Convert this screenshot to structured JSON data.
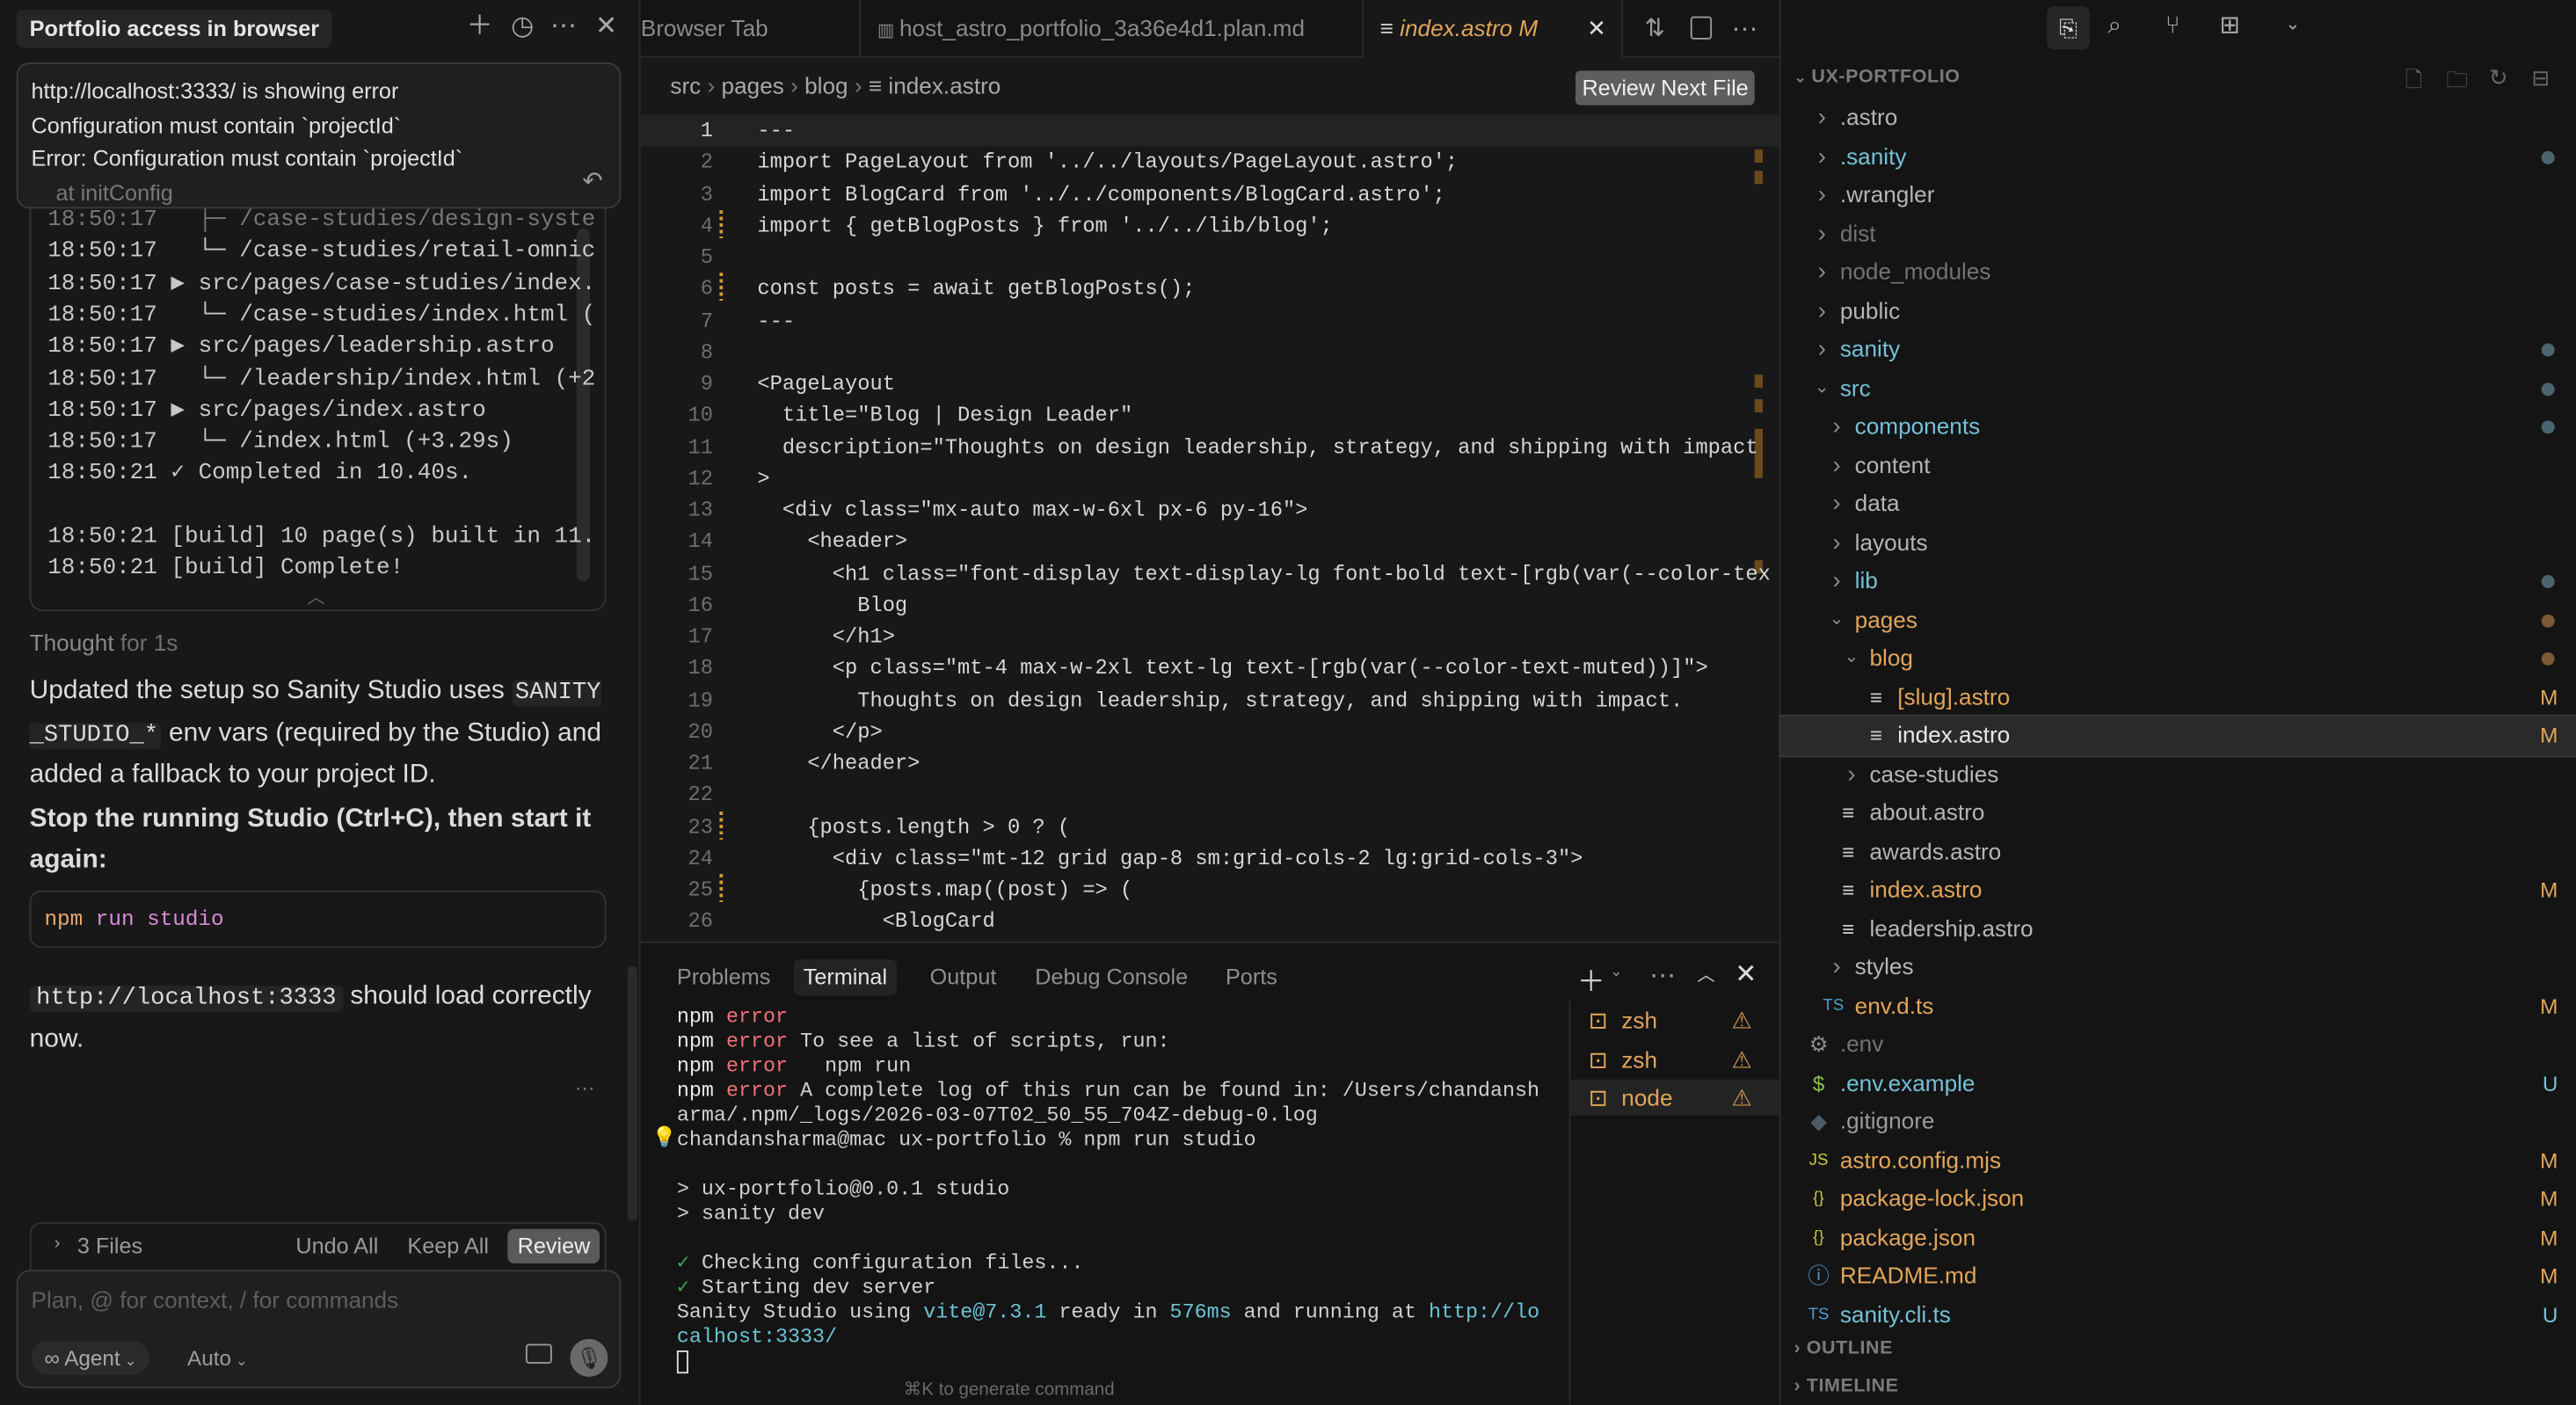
{
  "chat": {
    "title": "Portfolio access in browser",
    "header_icons": [
      "plus-icon",
      "history-icon",
      "more-icon",
      "close-icon"
    ],
    "popup": {
      "lines": [
        "http://localhost:3333/ is showing error",
        "Configuration must contain `projectId`",
        "Error: Configuration must contain `projectId`"
      ],
      "faded": "at initConfig"
    },
    "build_log": [
      "18:50:17   ├─ /case-studies/design-syste",
      "18:50:17   └─ /case-studies/retail-omnic",
      "18:50:17 ▶ src/pages/case-studies/index.",
      "18:50:17   └─ /case-studies/index.html (",
      "18:50:17 ▶ src/pages/leadership.astro",
      "18:50:17   └─ /leadership/index.html (+2",
      "18:50:17 ▶ src/pages/index.astro",
      "18:50:17   └─ /index.html (+3.29s)",
      "18:50:21 ✓ Completed in 10.40s.",
      "",
      "18:50:21 [build] 10 page(s) built in 11.",
      "18:50:21 [build] Complete!"
    ],
    "thought_label": "Thought",
    "thought_time": "for 1s",
    "msg1_a": "Updated the setup so Sanity Studio uses ",
    "msg1_code": "SANITY_STUDIO_*",
    "msg1_b": " env vars (required by the Studio) and added a fallback to your project ID.",
    "msg2": "Stop the running Studio (Ctrl+C), then start it again:",
    "code_block": {
      "cmd": "npm",
      "sub": "run",
      "arg": "studio"
    },
    "msg3_code": "http://localhost:3333",
    "msg3_b": " should load correctly now.",
    "more": "···",
    "files": {
      "count_label": "3 Files",
      "undo": "Undo All",
      "keep": "Keep All",
      "review": "Review"
    },
    "input": {
      "placeholder": "Plan, @ for context, / for commands",
      "mode": "Agent",
      "model": "Auto"
    }
  },
  "editor": {
    "tabs": [
      {
        "label": "Browser Tab",
        "active": false
      },
      {
        "label": "host_astro_portfolio_3a36e4d1.plan.md",
        "active": false
      },
      {
        "label": "index.astro",
        "badge": "M",
        "active": true
      }
    ],
    "breadcrumb": [
      "src",
      "pages",
      "blog",
      "index.astro"
    ],
    "review_next": "Review Next File",
    "lines": [
      "---",
      "import PageLayout from '../../layouts/PageLayout.astro';",
      "import BlogCard from '../../components/BlogCard.astro';",
      "import { getBlogPosts } from '../../lib/blog';",
      "",
      "const posts = await getBlogPosts();",
      "---",
      "",
      "<PageLayout",
      "  title=\"Blog | Design Leader\"",
      "  description=\"Thoughts on design leadership, strategy, and shipping with impact",
      ">",
      "  <div class=\"mx-auto max-w-6xl px-6 py-16\">",
      "    <header>",
      "      <h1 class=\"font-display text-display-lg font-bold text-[rgb(var(--color-tex",
      "        Blog",
      "      </h1>",
      "      <p class=\"mt-4 max-w-2xl text-lg text-[rgb(var(--color-text-muted))]\">",
      "        Thoughts on design leadership, strategy, and shipping with impact.",
      "      </p>",
      "    </header>",
      "",
      "    {posts.length > 0 ? (",
      "      <div class=\"mt-12 grid gap-8 sm:grid-cols-2 lg:grid-cols-3\">",
      "        {posts.map((post) => (",
      "          <BlogCard"
    ],
    "modified_lines": [
      4,
      6,
      23,
      25
    ]
  },
  "panel": {
    "tabs": [
      "Problems",
      "Terminal",
      "Output",
      "Debug Console",
      "Ports"
    ],
    "active_tab": "Terminal",
    "terminal": [
      [
        {
          "t": "npm ",
          "c": "#e8e8e8"
        },
        {
          "t": "error",
          "c": "#f07178"
        }
      ],
      [
        {
          "t": "npm ",
          "c": "#e8e8e8"
        },
        {
          "t": "error",
          "c": "#f07178"
        },
        {
          "t": " To see a list of scripts, run:",
          "c": "#d0d0d0"
        }
      ],
      [
        {
          "t": "npm ",
          "c": "#e8e8e8"
        },
        {
          "t": "error",
          "c": "#f07178"
        },
        {
          "t": "   npm run",
          "c": "#d0d0d0"
        }
      ],
      [
        {
          "t": "npm ",
          "c": "#e8e8e8"
        },
        {
          "t": "error",
          "c": "#f07178"
        },
        {
          "t": " A complete log of this run can be found in: /Users/chandansh",
          "c": "#d0d0d0"
        }
      ],
      [
        {
          "t": "arma/.npm/_logs/2026-03-07T02_50_55_704Z-debug-0.log",
          "c": "#d0d0d0"
        }
      ],
      [
        {
          "t": "chandansharma@mac ux-portfolio % npm run studio",
          "c": "#d0d0d0"
        }
      ],
      [],
      [
        {
          "t": "> ux-portfolio@0.0.1 studio",
          "c": "#d0d0d0"
        }
      ],
      [
        {
          "t": "> sanity dev",
          "c": "#d0d0d0"
        }
      ],
      [],
      [
        {
          "t": "✓ ",
          "c": "#3fa65a"
        },
        {
          "t": "Checking configuration files...",
          "c": "#d0d0d0"
        }
      ],
      [
        {
          "t": "✓ ",
          "c": "#3fa65a"
        },
        {
          "t": "Starting dev server",
          "c": "#d0d0d0"
        }
      ],
      [
        {
          "t": "Sanity Studio using ",
          "c": "#d0d0d0"
        },
        {
          "t": "vite@7.3.1",
          "c": "#6cc3d5"
        },
        {
          "t": " ready in ",
          "c": "#d0d0d0"
        },
        {
          "t": "576ms",
          "c": "#6cc3d5"
        },
        {
          "t": " and running at ",
          "c": "#d0d0d0"
        },
        {
          "t": "http://lo",
          "c": "#6cc3d5"
        }
      ],
      [
        {
          "t": "calhost:3333/",
          "c": "#6cc3d5"
        }
      ]
    ],
    "hint": "⌘K to generate command",
    "terminals": [
      {
        "name": "zsh"
      },
      {
        "name": "zsh"
      },
      {
        "name": "node",
        "selected": true
      }
    ]
  },
  "explorer": {
    "title": "UX-PORTFOLIO",
    "items": [
      {
        "label": ".astro",
        "depth": 0,
        "kind": "closed",
        "color": "#b5b5b5"
      },
      {
        "label": ".sanity",
        "depth": 0,
        "kind": "closed",
        "color": "#74c0d6",
        "dot": "#4a6470"
      },
      {
        "label": ".wrangler",
        "depth": 0,
        "kind": "closed",
        "color": "#b5b5b5"
      },
      {
        "label": "dist",
        "depth": 0,
        "kind": "closed",
        "color": "#737373"
      },
      {
        "label": "node_modules",
        "depth": 0,
        "kind": "closed",
        "color": "#737373"
      },
      {
        "label": "public",
        "depth": 0,
        "kind": "closed",
        "color": "#b5b5b5"
      },
      {
        "label": "sanity",
        "depth": 0,
        "kind": "closed",
        "color": "#74c0d6",
        "dot": "#4a6470"
      },
      {
        "label": "src",
        "depth": 0,
        "kind": "open",
        "color": "#74c0d6",
        "dot": "#4a6470"
      },
      {
        "label": "components",
        "depth": 1,
        "kind": "closed",
        "color": "#74c0d6",
        "dot": "#4a6470"
      },
      {
        "label": "content",
        "depth": 1,
        "kind": "closed",
        "color": "#b5b5b5"
      },
      {
        "label": "data",
        "depth": 1,
        "kind": "closed",
        "color": "#b5b5b5"
      },
      {
        "label": "layouts",
        "depth": 1,
        "kind": "closed",
        "color": "#b5b5b5"
      },
      {
        "label": "lib",
        "depth": 1,
        "kind": "closed",
        "color": "#74c0d6",
        "dot": "#4a6470"
      },
      {
        "label": "pages",
        "depth": 1,
        "kind": "open",
        "color": "#e2a55a",
        "dot": "#7a5a33"
      },
      {
        "label": "blog",
        "depth": 2,
        "kind": "open",
        "color": "#e2a55a",
        "dot": "#7a5a33"
      },
      {
        "label": "[slug].astro",
        "depth": 3,
        "kind": "file",
        "icon": "≡",
        "iconColor": "#cfcfcf",
        "color": "#e2a55a",
        "badge": "M"
      },
      {
        "label": "index.astro",
        "depth": 3,
        "kind": "file",
        "icon": "≡",
        "iconColor": "#cfcfcf",
        "color": "#e8e8e8",
        "badge": "M",
        "selected": true
      },
      {
        "label": "case-studies",
        "depth": 2,
        "kind": "closed",
        "color": "#b5b5b5"
      },
      {
        "label": "about.astro",
        "depth": 2,
        "kind": "file",
        "icon": "≡",
        "iconColor": "#cfcfcf",
        "color": "#b5b5b5"
      },
      {
        "label": "awards.astro",
        "depth": 2,
        "kind": "file",
        "icon": "≡",
        "iconColor": "#cfcfcf",
        "color": "#b5b5b5"
      },
      {
        "label": "index.astro",
        "depth": 2,
        "kind": "file",
        "icon": "≡",
        "iconColor": "#cfcfcf",
        "color": "#e2a55a",
        "badge": "M"
      },
      {
        "label": "leadership.astro",
        "depth": 2,
        "kind": "file",
        "icon": "≡",
        "iconColor": "#cfcfcf",
        "color": "#b5b5b5"
      },
      {
        "label": "styles",
        "depth": 1,
        "kind": "closed",
        "color": "#b5b5b5"
      },
      {
        "label": "env.d.ts",
        "depth": 1,
        "kind": "file",
        "icon": "TS",
        "iconColor": "#4d9fd1",
        "color": "#e2a55a",
        "badge": "M"
      },
      {
        "label": ".env",
        "depth": 0,
        "kind": "file",
        "icon": "⚙",
        "iconColor": "#8a8a8a",
        "color": "#737373"
      },
      {
        "label": ".env.example",
        "depth": 0,
        "kind": "file",
        "icon": "$",
        "iconColor": "#8dc149",
        "color": "#74c0d6",
        "badge": "U"
      },
      {
        "label": ".gitignore",
        "depth": 0,
        "kind": "file",
        "icon": "◆",
        "iconColor": "#4e5a63",
        "color": "#9a9a9a"
      },
      {
        "label": "astro.config.mjs",
        "depth": 0,
        "kind": "file",
        "icon": "JS",
        "iconColor": "#cbcb41",
        "color": "#e2a55a",
        "badge": "M"
      },
      {
        "label": "package-lock.json",
        "depth": 0,
        "kind": "file",
        "icon": "{}",
        "iconColor": "#cbcb41",
        "color": "#e2a55a",
        "badge": "M"
      },
      {
        "label": "package.json",
        "depth": 0,
        "kind": "file",
        "icon": "{}",
        "iconColor": "#cbcb41",
        "color": "#e2a55a",
        "badge": "M"
      },
      {
        "label": "README.md",
        "depth": 0,
        "kind": "file",
        "icon": "ⓘ",
        "iconColor": "#4d9fd1",
        "color": "#e2a55a",
        "badge": "M"
      },
      {
        "label": "sanity.cli.ts",
        "depth": 0,
        "kind": "file",
        "icon": "TS",
        "iconColor": "#4d9fd1",
        "color": "#74c0d6",
        "badge": "U"
      }
    ],
    "sections": [
      "OUTLINE",
      "TIMELINE"
    ]
  },
  "colors": {
    "modified": "#e2a55a",
    "untracked": "#74c0d6",
    "error": "#f07178",
    "link": "#6cc3d5"
  }
}
